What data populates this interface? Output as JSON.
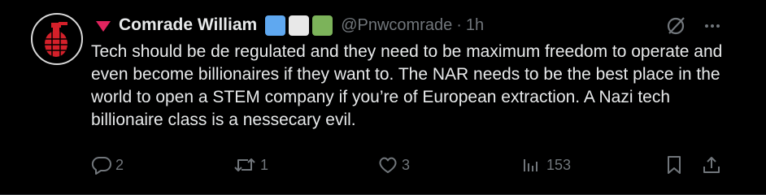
{
  "tweet": {
    "display_name": "Comrade William",
    "handle": "@Pnwcomrade",
    "separator": "·",
    "time": "1h",
    "text": "Tech should be de regulated and they need to be maximum freedom to operate and even become billionaires if they want to. The NAR needs to be the best place in the world to open a STEM company if you’re of European extraction. A Nazi tech billionaire class is a nessecary evil.",
    "name_emojis": [
      "blue-square",
      "white-square",
      "green-square"
    ],
    "flag_emoji": "red-down-triangle"
  },
  "actions": {
    "reply_count": "2",
    "retweet_count": "1",
    "like_count": "3",
    "views_count": "153"
  },
  "colors": {
    "background": "#000000",
    "text_primary": "#e7e9ea",
    "text_secondary": "#71767b",
    "flag_red": "#e0245e",
    "emoji_blue": "#5fa8f0",
    "emoji_white": "#e8e8e8",
    "emoji_green": "#7cb35a"
  }
}
